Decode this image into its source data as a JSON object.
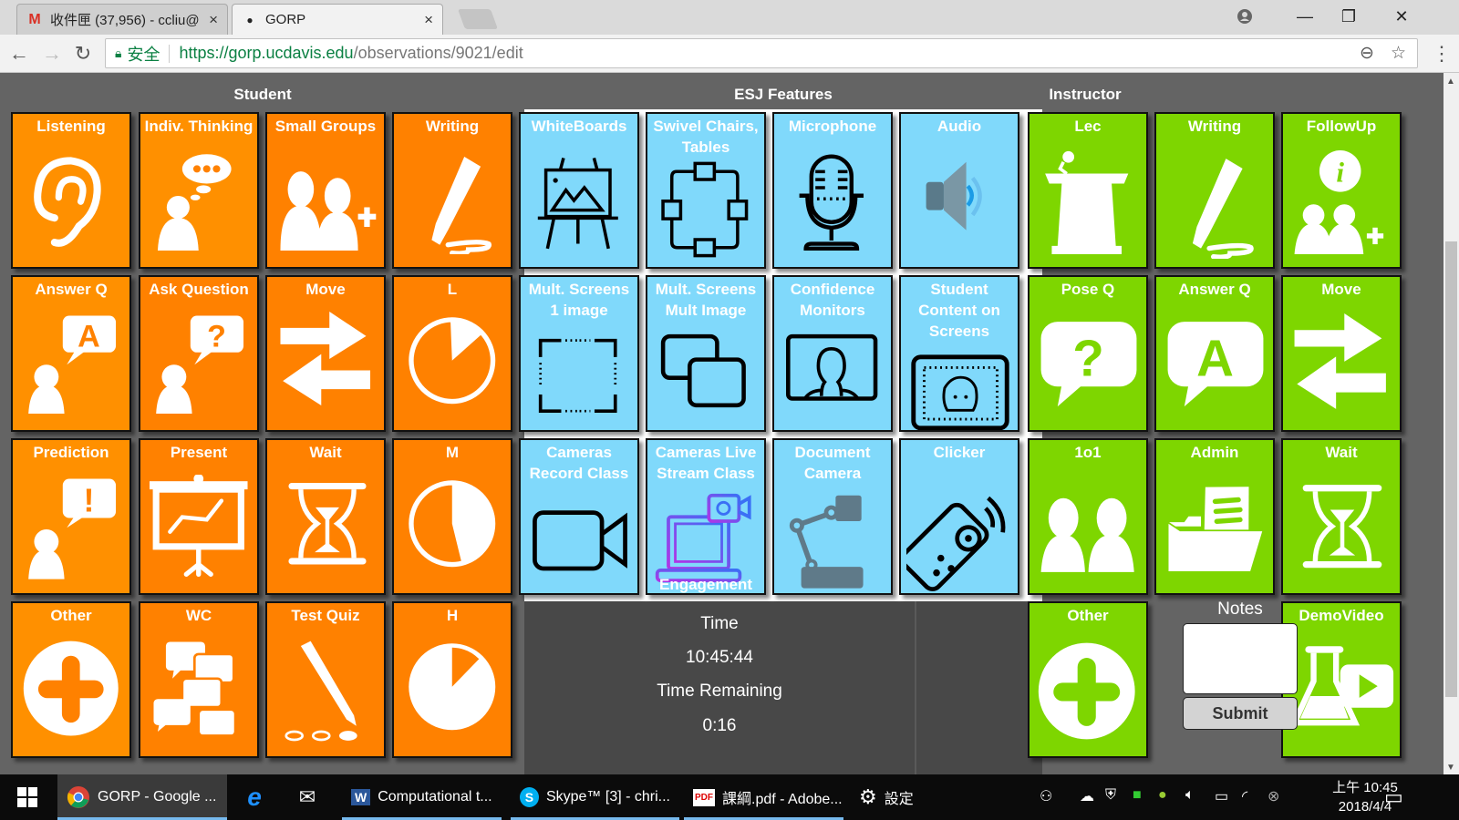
{
  "browser": {
    "tabs": [
      {
        "title": "收件匣 (37,956) - ccliu@",
        "icon": "gmail-icon",
        "active": false
      },
      {
        "title": "GORP",
        "icon": "gorp-icon",
        "active": true
      }
    ],
    "url_secure_label": "安全",
    "url_host": "https://gorp.ucdavis.edu",
    "url_path": "/observations/9021/edit",
    "window_controls": [
      "profile-icon",
      "minimize-icon",
      "restore-icon",
      "close-icon"
    ]
  },
  "sections": {
    "student": "Student",
    "esj": "ESJ Features",
    "instructor": "Instructor"
  },
  "student_tiles": [
    {
      "label": "Listening",
      "icon": "ear-icon"
    },
    {
      "label": "Indiv. Thinking",
      "icon": "thinking-person-icon"
    },
    {
      "label": "Small Groups",
      "icon": "group-plus-icon"
    },
    {
      "label": "Writing",
      "icon": "marker-icon"
    },
    {
      "label": "Answer Q",
      "icon": "person-answer-icon"
    },
    {
      "label": "Ask Question",
      "icon": "person-question-icon"
    },
    {
      "label": "Move",
      "icon": "arrows-exchange-icon"
    },
    {
      "label": "L",
      "icon": "pie-low-icon"
    },
    {
      "label": "Prediction",
      "icon": "person-exclaim-icon"
    },
    {
      "label": "Present",
      "icon": "presentation-icon"
    },
    {
      "label": "Wait",
      "icon": "hourglass-icon"
    },
    {
      "label": "M",
      "icon": "pie-medium-icon"
    },
    {
      "label": "Other",
      "icon": "plus-circle-icon"
    },
    {
      "label": "WC",
      "icon": "chat-bubbles-icon"
    },
    {
      "label": "Test Quiz",
      "icon": "pencil-quiz-icon"
    },
    {
      "label": "H",
      "icon": "pie-high-icon"
    }
  ],
  "esj_tiles": [
    {
      "label": "WhiteBoards",
      "icon": "easel-icon"
    },
    {
      "label": "Swivel Chairs, Tables",
      "icon": "tables-layout-icon"
    },
    {
      "label": "Microphone",
      "icon": "microphone-icon"
    },
    {
      "label": "Audio",
      "icon": "speaker-icon"
    },
    {
      "label": "Mult. Screens 1 image",
      "icon": "screen-frame-icon"
    },
    {
      "label": "Mult. Screens Mult Image",
      "icon": "multi-screen-icon"
    },
    {
      "label": "Confidence Monitors",
      "icon": "monitor-person-icon"
    },
    {
      "label": "Student Content on Screens",
      "icon": "screen-student-icon"
    },
    {
      "label": "Cameras Record Class",
      "icon": "video-camera-icon"
    },
    {
      "label": "Cameras Live Stream Class",
      "icon": "livestream-laptop-icon",
      "sublabel": "Engagement"
    },
    {
      "label": "Document Camera",
      "icon": "document-camera-icon"
    },
    {
      "label": "Clicker",
      "icon": "clicker-remote-icon"
    }
  ],
  "instructor_tiles": [
    {
      "label": "Lec",
      "icon": "podium-icon"
    },
    {
      "label": "Writing",
      "icon": "marker-icon"
    },
    {
      "label": "FollowUp",
      "icon": "info-group-icon"
    },
    {
      "label": "Pose Q",
      "icon": "question-bubble-icon"
    },
    {
      "label": "Answer Q",
      "icon": "answer-bubble-icon"
    },
    {
      "label": "Move",
      "icon": "arrows-exchange-icon"
    },
    {
      "label": "1o1",
      "icon": "two-people-icon"
    },
    {
      "label": "Admin",
      "icon": "folder-document-icon"
    },
    {
      "label": "Wait",
      "icon": "hourglass-icon"
    },
    {
      "label": "Other",
      "icon": "plus-circle-icon"
    },
    {
      "label": "DemoVideo",
      "icon": "flask-video-icon"
    }
  ],
  "timer": {
    "time_label": "Time",
    "time_value": "10:45:44",
    "remaining_label": "Time Remaining",
    "remaining_value": "0:16"
  },
  "notes": {
    "title": "Notes",
    "value": "",
    "submit_label": "Submit"
  },
  "colors": {
    "student": "#ff8100",
    "esj": "#80d9fb",
    "instructor": "#7ed600",
    "page_bg": "#646464"
  },
  "taskbar": {
    "items": [
      {
        "label": "GORP - Google ...",
        "icon": "chrome-icon",
        "active": true
      },
      {
        "label": "",
        "icon": "internet-explorer-icon"
      },
      {
        "label": "",
        "icon": "mail-icon"
      },
      {
        "label": "Computational t...",
        "icon": "word-icon"
      },
      {
        "label": "Skype™ [3] - chri...",
        "icon": "skype-icon"
      },
      {
        "label": "課綱.pdf - Adobe...",
        "icon": "pdf-icon"
      },
      {
        "label": "設定",
        "icon": "settings-icon"
      }
    ],
    "clock_time": "上午 10:45",
    "clock_date": "2018/4/4"
  }
}
